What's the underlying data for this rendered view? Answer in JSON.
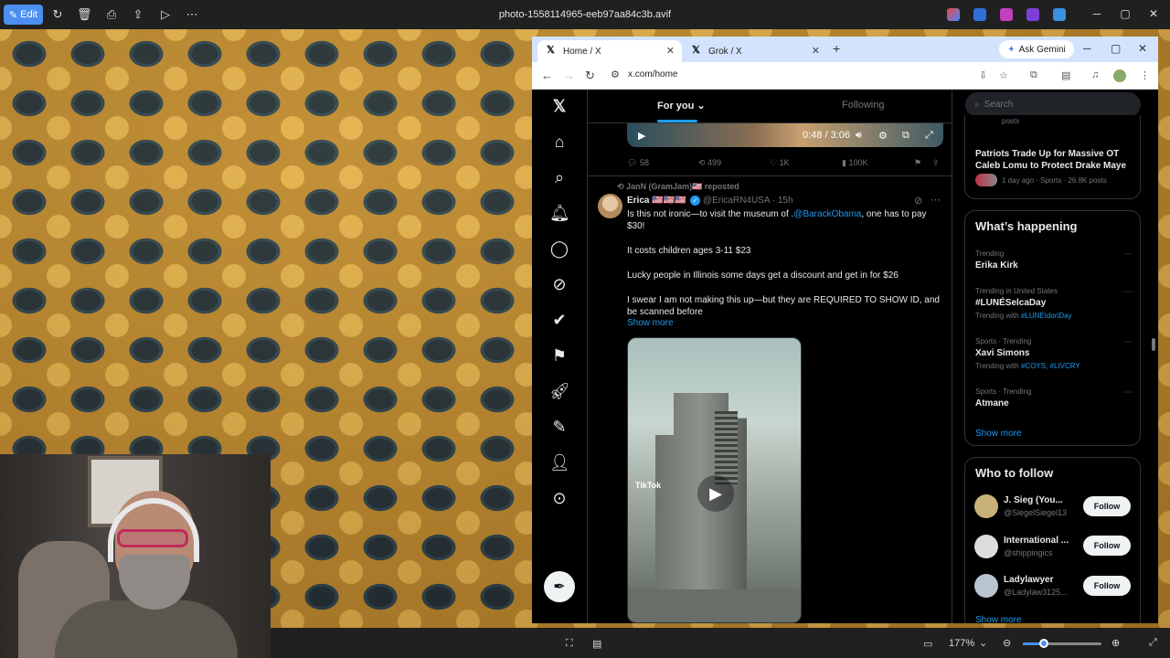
{
  "viewer": {
    "edit_label": "Edit",
    "file_title": "photo-1558114965-eeb97aa84c3b.avif",
    "zoom_level": "177%"
  },
  "browser": {
    "tabs": [
      {
        "label": "Home / X"
      },
      {
        "label": "Grok / X"
      }
    ],
    "ask_gemini": "Ask Gemini",
    "url": "x.com/home"
  },
  "timeline": {
    "tab_for_you": "For you",
    "tab_following": "Following",
    "video_time": "0:48 / 3:06",
    "prev_actions": {
      "replies": "58",
      "reposts": "499",
      "likes": "1K",
      "views": "100K"
    },
    "repost_label": "JanN (GramJam)🇺🇸 reposted",
    "post": {
      "name": "Erica 🇺🇸🇺🇸🇺🇸",
      "handle_time": "@EricaRN4USA · 15h",
      "line1_a": "Is this not ironic—to visit the museum of .",
      "line1_mention": "@BarackObama",
      "line1_b": ", one has to pay $30!",
      "line2": "It costs children ages 3-11 $23",
      "line3": "Lucky people in Illinois some days get a discount and get in for $26",
      "line4": "I swear I am not making this up—but they are REQUIRED TO SHOW ID, and be scanned before",
      "show_more": "Show more",
      "tiktok_label": "TikTok"
    }
  },
  "sidebar": {
    "search_placeholder": "Search",
    "top_partial": "posts",
    "top_trend_title": "Patriots Trade Up for Massive OT Caleb Lomu to Protect Drake Maye",
    "top_trend_meta": "1 day ago · Sports · 26.8K posts",
    "whats_happening": "What’s happening",
    "trends": [
      {
        "meta": "Trending",
        "name": "Erika Kirk",
        "with_label": "",
        "with_tags": ""
      },
      {
        "meta": "Trending in United States",
        "name": "#LUNÉSelcaDay",
        "with_label": "Trending with",
        "with_tags": "#LUNÉIdoriDay"
      },
      {
        "meta": "Sports · Trending",
        "name": "Xavi Simons",
        "with_label": "Trending with",
        "with_tags": "#COYS, #LIVCRY"
      },
      {
        "meta": "Sports · Trending",
        "name": "Atmane",
        "with_label": "",
        "with_tags": ""
      }
    ],
    "show_more": "Show more",
    "who_to_follow": "Who to follow",
    "follow_label": "Follow",
    "suggestions": [
      {
        "name": "J. Sieg (You...",
        "handle": "@SiegelSiegel13"
      },
      {
        "name": "International ...",
        "handle": "@shippingics"
      },
      {
        "name": "Ladylawyer",
        "handle": "@Ladylaw3125..."
      }
    ],
    "show_more_bottom": "Show more"
  },
  "colors": {
    "accent": "#1d9bf0",
    "x_background": "#000000",
    "viewer_accent": "#4c8ff0"
  }
}
